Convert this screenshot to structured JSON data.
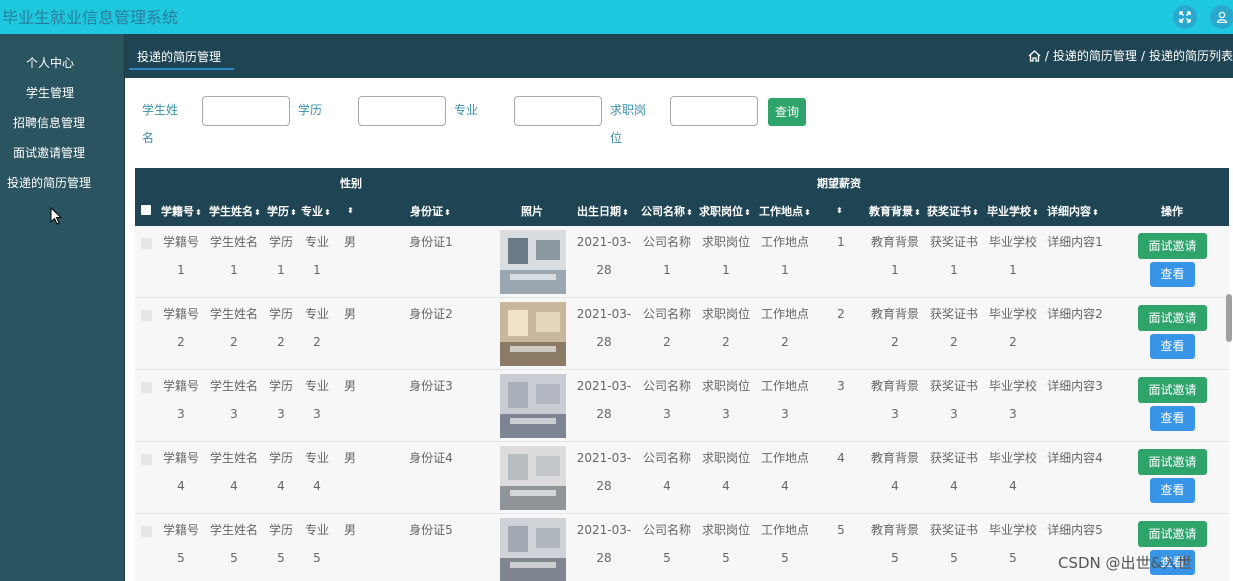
{
  "app": {
    "title": "毕业生就业信息管理系统"
  },
  "topbar": {
    "fullscreen_icon": "expand-icon",
    "user_icon": "user-icon"
  },
  "sidebar": {
    "items": [
      {
        "label": "个人中心"
      },
      {
        "label": "学生管理"
      },
      {
        "label": "招聘信息管理"
      },
      {
        "label": "面试邀请管理"
      },
      {
        "label": "投递的简历管理"
      }
    ]
  },
  "header": {
    "tab": "投递的简历管理",
    "breadcrumb": [
      "投递的简历管理",
      "投递的简历列表"
    ]
  },
  "search": {
    "fields": [
      {
        "label": "学生姓名",
        "value": ""
      },
      {
        "label": "学历",
        "value": ""
      },
      {
        "label": "专业",
        "value": ""
      },
      {
        "label": "求职岗位",
        "value": ""
      }
    ],
    "button": "查询"
  },
  "table": {
    "group_headers": {
      "gender": "性别",
      "salary": "期望薪资"
    },
    "columns": [
      "学籍号",
      "学生姓名",
      "学历",
      "专业",
      "",
      "身份证",
      "照片",
      "出生日期",
      "公司名称",
      "求职岗位",
      "工作地点",
      "",
      "教育背景",
      "获奖证书",
      "毕业学校",
      "详细内容",
      "操作"
    ],
    "rows": [
      {
        "xjh": "学籍号",
        "xjh2": "1",
        "name": "学生姓名",
        "name2": "1",
        "edu": "学历",
        "edu2": "1",
        "major": "专业",
        "major2": "1",
        "gender": "男",
        "id": "身份证1",
        "birth": "2021-03-",
        "birth2": "28",
        "company": "公司名称",
        "company2": "1",
        "post": "求职岗位",
        "post2": "1",
        "place": "工作地点",
        "place2": "1",
        "salary": "1",
        "bg": "教育背景",
        "bg2": "1",
        "cert": "获奖证书",
        "cert2": "1",
        "school": "毕业学校",
        "school2": "1",
        "detail": "详细内容1",
        "invite": "面试邀请",
        "view": "查看"
      },
      {
        "xjh": "学籍号",
        "xjh2": "2",
        "name": "学生姓名",
        "name2": "2",
        "edu": "学历",
        "edu2": "2",
        "major": "专业",
        "major2": "2",
        "gender": "男",
        "id": "身份证2",
        "birth": "2021-03-",
        "birth2": "28",
        "company": "公司名称",
        "company2": "2",
        "post": "求职岗位",
        "post2": "2",
        "place": "工作地点",
        "place2": "2",
        "salary": "2",
        "bg": "教育背景",
        "bg2": "2",
        "cert": "获奖证书",
        "cert2": "2",
        "school": "毕业学校",
        "school2": "2",
        "detail": "详细内容2",
        "invite": "面试邀请",
        "view": "查看"
      },
      {
        "xjh": "学籍号",
        "xjh2": "3",
        "name": "学生姓名",
        "name2": "3",
        "edu": "学历",
        "edu2": "3",
        "major": "专业",
        "major2": "3",
        "gender": "男",
        "id": "身份证3",
        "birth": "2021-03-",
        "birth2": "28",
        "company": "公司名称",
        "company2": "3",
        "post": "求职岗位",
        "post2": "3",
        "place": "工作地点",
        "place2": "3",
        "salary": "3",
        "bg": "教育背景",
        "bg2": "3",
        "cert": "获奖证书",
        "cert2": "3",
        "school": "毕业学校",
        "school2": "3",
        "detail": "详细内容3",
        "invite": "面试邀请",
        "view": "查看"
      },
      {
        "xjh": "学籍号",
        "xjh2": "4",
        "name": "学生姓名",
        "name2": "4",
        "edu": "学历",
        "edu2": "4",
        "major": "专业",
        "major2": "4",
        "gender": "男",
        "id": "身份证4",
        "birth": "2021-03-",
        "birth2": "28",
        "company": "公司名称",
        "company2": "4",
        "post": "求职岗位",
        "post2": "4",
        "place": "工作地点",
        "place2": "4",
        "salary": "4",
        "bg": "教育背景",
        "bg2": "4",
        "cert": "获奖证书",
        "cert2": "4",
        "school": "毕业学校",
        "school2": "4",
        "detail": "详细内容4",
        "invite": "面试邀请",
        "view": "查看"
      },
      {
        "xjh": "学籍号",
        "xjh2": "5",
        "name": "学生姓名",
        "name2": "5",
        "edu": "学历",
        "edu2": "5",
        "major": "专业",
        "major2": "5",
        "gender": "男",
        "id": "身份证5",
        "birth": "2021-03-",
        "birth2": "28",
        "company": "公司名称",
        "company2": "5",
        "post": "求职岗位",
        "post2": "5",
        "place": "工作地点",
        "place2": "5",
        "salary": "5",
        "bg": "教育背景",
        "bg2": "5",
        "cert": "获奖证书",
        "cert2": "5",
        "school": "毕业学校",
        "school2": "5",
        "detail": "详细内容5",
        "invite": "面试邀请",
        "view": "查看"
      }
    ]
  },
  "watermark": "CSDN @出世&入世",
  "colors": {
    "topbar": "#1ec8df",
    "sidebar": "#2a5460",
    "header": "#1f4555",
    "invite": "#2ea36a",
    "view": "#3794e6"
  }
}
